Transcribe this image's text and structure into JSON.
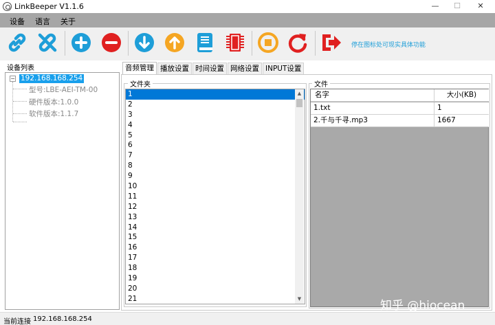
{
  "window": {
    "title": "LinkBeeper V1.1.6",
    "controls": {
      "minimize": "—",
      "maximize": "☐",
      "close": "✕"
    }
  },
  "menu": [
    "设备",
    "语言",
    "关于"
  ],
  "toolbar": {
    "buttons": [
      {
        "icon": "link-icon",
        "color": "#1e9ed8"
      },
      {
        "icon": "unlink-icon",
        "color": "#1e9ed8"
      },
      {
        "icon": "add-icon",
        "color": "#1e9ed8"
      },
      {
        "icon": "remove-icon",
        "color": "#e02020"
      },
      {
        "icon": "arrow-down-icon",
        "color": "#1e9ed8"
      },
      {
        "icon": "arrow-up-icon",
        "color": "#f5a623"
      },
      {
        "icon": "book-icon",
        "color": "#1e9ed8"
      },
      {
        "icon": "chip-icon",
        "color": "#e02020"
      },
      {
        "icon": "stop-icon",
        "color": "#f5a623"
      },
      {
        "icon": "refresh-icon",
        "color": "#e02020"
      },
      {
        "icon": "exit-icon",
        "color": "#e02020"
      }
    ],
    "hint": "停在图标处可现实具体功能"
  },
  "device_panel": {
    "label": "设备列表",
    "root": "192.168.168.254",
    "root_toggle": "−",
    "children": [
      "型号:LBE-AEI-TM-00",
      "硬件版本:1.0.0",
      "软件版本:1.1.7"
    ]
  },
  "tabs": [
    "音频管理",
    "播放设置",
    "时间设置",
    "网络设置",
    "INPUT设置"
  ],
  "folder_group": {
    "title": "文件夹",
    "items": [
      "1",
      "2",
      "3",
      "4",
      "5",
      "6",
      "7",
      "8",
      "9",
      "10",
      "11",
      "12",
      "13",
      "14",
      "15",
      "16",
      "17",
      "18",
      "19",
      "20",
      "21"
    ],
    "selected": "1",
    "scroll_up": "▲",
    "scroll_down": "▼"
  },
  "file_group": {
    "title": "文件",
    "columns": [
      "名字",
      "大小(KB)"
    ],
    "rows": [
      {
        "name": "1.txt",
        "size": "1"
      },
      {
        "name": "2.千与千寻.mp3",
        "size": "1667"
      }
    ]
  },
  "status": {
    "label": "当前连接",
    "value": "192.168.168.254"
  },
  "watermark": "知乎 @hiocean"
}
